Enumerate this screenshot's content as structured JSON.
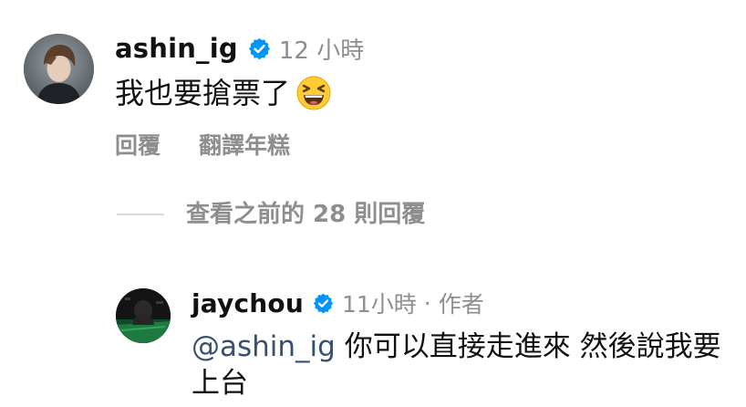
{
  "top_comment": {
    "username": "ashin_ig",
    "verified_icon": "verified-badge-icon",
    "time": "12 小時",
    "text": "我也要搶票了",
    "emoji": "grinning-squinting-face-emoji",
    "actions": {
      "reply": "回覆",
      "translate": "翻譯年糕"
    }
  },
  "view_previous": {
    "label": "查看之前的 28 則回覆"
  },
  "reply_comment": {
    "username": "jaychou",
    "verified_icon": "verified-badge-icon",
    "time": "11小時",
    "separator": "·",
    "author_tag": "作者",
    "mention": "@ashin_ig",
    "text": " 你可以直接走進來 然後說我要上台"
  },
  "colors": {
    "verified_blue": "#0095f6",
    "secondary_text": "#8e8e8e",
    "mention": "#37506f",
    "divider": "#dbdbdb"
  }
}
